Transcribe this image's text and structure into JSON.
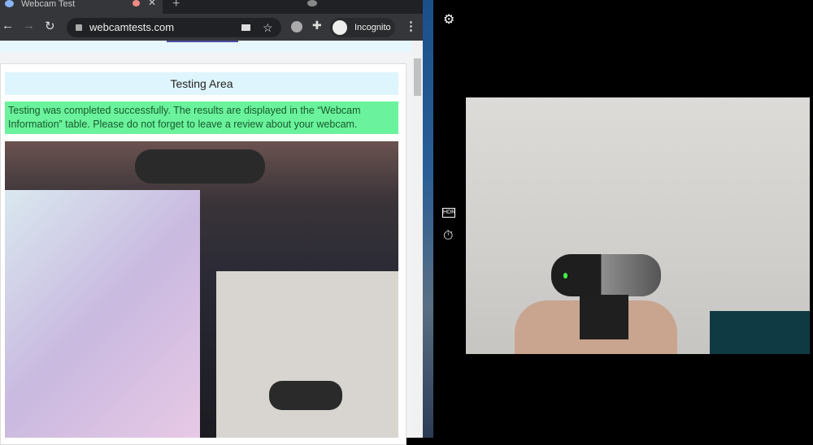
{
  "browser": {
    "tab_title": "Webcam Test",
    "new_tab": "+",
    "url": "webcamtests.com",
    "profile_label": "Incognito"
  },
  "page": {
    "section_title": "Testing Area",
    "message": "Testing was completed successfully. The results are displayed in the “Webcam Information” table. Please do not forget to leave a review about your webcam."
  },
  "camera_app": {
    "icons": [
      "settings-icon",
      "hdr-off-icon",
      "timer-off-icon"
    ]
  }
}
